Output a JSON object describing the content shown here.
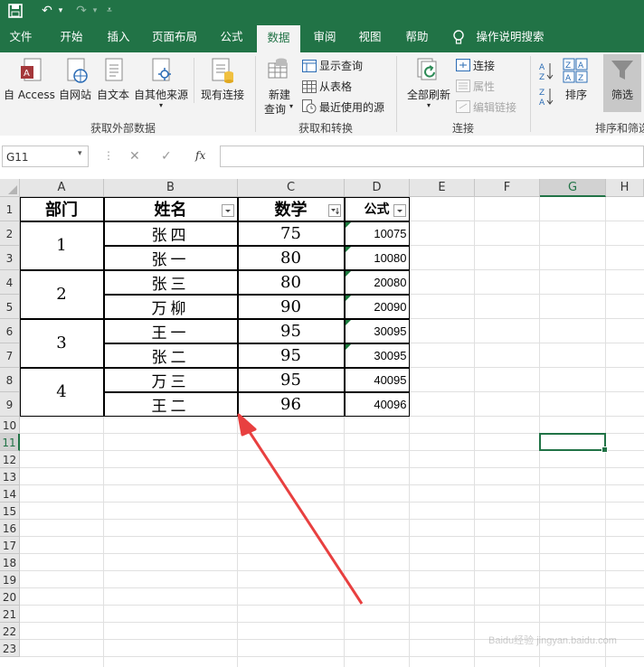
{
  "app": {
    "title_icons": [
      "save-icon",
      "undo-icon",
      "redo-icon",
      "customize-qat-icon"
    ]
  },
  "tabs": [
    "文件",
    "开始",
    "插入",
    "页面布局",
    "公式",
    "数据",
    "审阅",
    "视图",
    "帮助"
  ],
  "active_tab": "数据",
  "tell_me": "操作说明搜索",
  "ribbon": {
    "group1": {
      "label": "获取外部数据",
      "buttons": [
        "自 Access",
        "自网站",
        "自文本",
        "自其他来源",
        "现有连接"
      ]
    },
    "group2": {
      "label": "获取和转换",
      "new_query_line1": "新建",
      "new_query_line2": "查询",
      "show_queries": "显示查询",
      "from_table": "从表格",
      "recent_sources": "最近使用的源"
    },
    "group3": {
      "label": "连接",
      "refresh_all": "全部刷新",
      "connections": "连接",
      "properties": "属性",
      "edit_links": "编辑链接"
    },
    "group4": {
      "label": "排序和筛选",
      "sort": "排序",
      "filter": "筛选"
    }
  },
  "formula_bar": {
    "name_box": "G11",
    "cancel": "✕",
    "enter": "✓",
    "fx": "fx",
    "value": ""
  },
  "columns": [
    "A",
    "B",
    "C",
    "D",
    "E",
    "F",
    "G",
    "H"
  ],
  "rows": [
    "1",
    "2",
    "3",
    "4",
    "5",
    "6",
    "7",
    "8",
    "9",
    "10",
    "11",
    "12",
    "13",
    "14",
    "15",
    "16",
    "17",
    "18",
    "19",
    "20",
    "21",
    "22",
    "23"
  ],
  "table": {
    "headers": [
      "部门",
      "姓名",
      "数学",
      "公式"
    ],
    "departments": [
      "1",
      "2",
      "3",
      "4"
    ],
    "names": [
      "张四",
      "张一",
      "张三",
      "万柳",
      "王一",
      "张二",
      "万三",
      "王二"
    ],
    "math": [
      "75",
      "80",
      "80",
      "90",
      "95",
      "95",
      "95",
      "96"
    ],
    "formula": [
      "10075",
      "10080",
      "20080",
      "20090",
      "30095",
      "30095",
      "40095",
      "40096"
    ]
  },
  "watermark": "Baidu经验 jingyan.baidu.com",
  "colors": {
    "excel_green": "#217346",
    "arrow": "#e84040",
    "selection": "#217346"
  }
}
